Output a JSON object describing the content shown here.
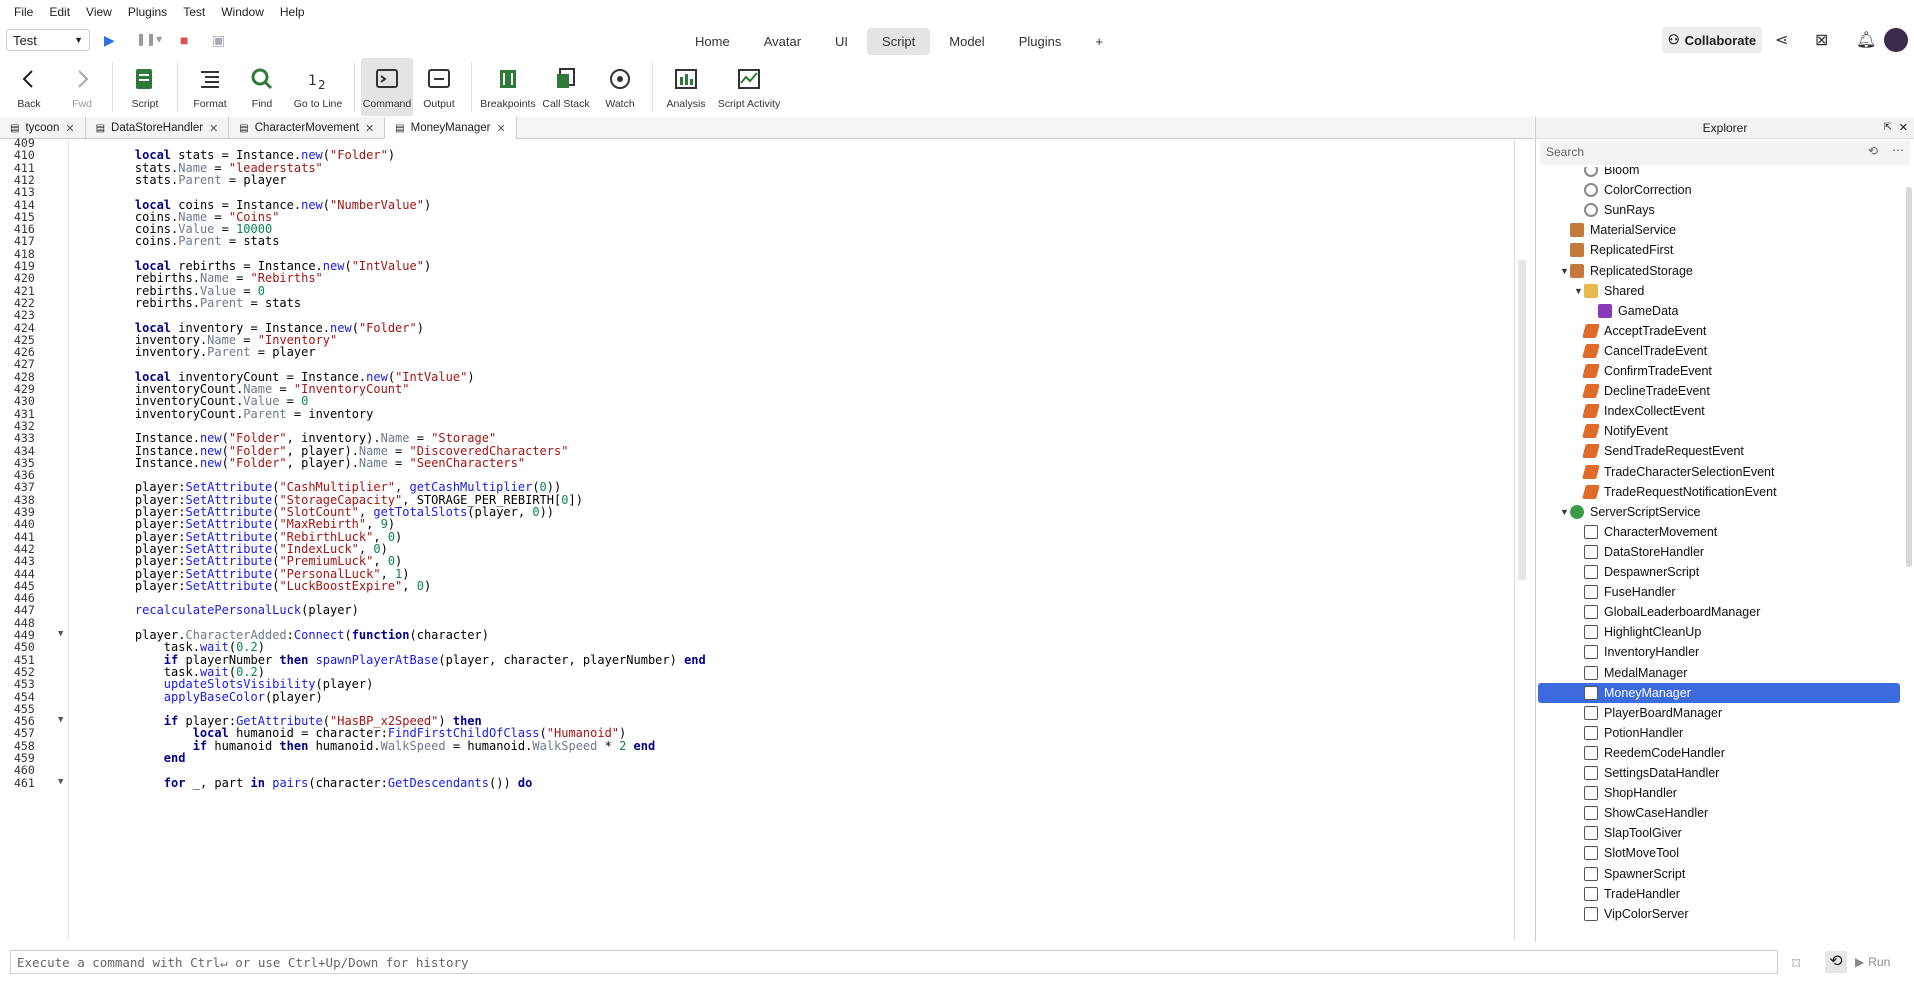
{
  "menu": [
    "File",
    "Edit",
    "View",
    "Plugins",
    "Test",
    "Window",
    "Help"
  ],
  "place": {
    "value": "Test"
  },
  "top_tabs": [
    "Home",
    "Avatar",
    "UI",
    "Script",
    "Model",
    "Plugins",
    "+"
  ],
  "collaborate": "Collaborate",
  "toolbar": {
    "back": "Back",
    "fwd": "Fwd",
    "script": "Script",
    "format": "Format",
    "find": "Find",
    "goto": "Go to Line",
    "command": "Command",
    "output": "Output",
    "breakpoints": "Breakpoints",
    "callstack": "Call Stack",
    "watch": "Watch",
    "analysis": "Analysis",
    "activity": "Script Activity"
  },
  "doc_tabs": [
    "tycoon",
    "DataStoreHandler",
    "CharacterMovement",
    "MoneyManager"
  ],
  "code_lines": [
    {
      "n": "409",
      "t": ""
    },
    {
      "n": "410",
      "t": "    local stats = Instance.new(\"Folder\")"
    },
    {
      "n": "411",
      "t": "    stats.Name = \"leaderstats\""
    },
    {
      "n": "412",
      "t": "    stats.Parent = player"
    },
    {
      "n": "413",
      "t": ""
    },
    {
      "n": "414",
      "t": "    local coins = Instance.new(\"NumberValue\")"
    },
    {
      "n": "415",
      "t": "    coins.Name = \"Coins\""
    },
    {
      "n": "416",
      "t": "    coins.Value = 10000"
    },
    {
      "n": "417",
      "t": "    coins.Parent = stats"
    },
    {
      "n": "418",
      "t": ""
    },
    {
      "n": "419",
      "t": "    local rebirths = Instance.new(\"IntValue\")"
    },
    {
      "n": "420",
      "t": "    rebirths.Name = \"Rebirths\""
    },
    {
      "n": "421",
      "t": "    rebirths.Value = 0"
    },
    {
      "n": "422",
      "t": "    rebirths.Parent = stats"
    },
    {
      "n": "423",
      "t": ""
    },
    {
      "n": "424",
      "t": "    local inventory = Instance.new(\"Folder\")"
    },
    {
      "n": "425",
      "t": "    inventory.Name = \"Inventory\""
    },
    {
      "n": "426",
      "t": "    inventory.Parent = player"
    },
    {
      "n": "427",
      "t": ""
    },
    {
      "n": "428",
      "t": "    local inventoryCount = Instance.new(\"IntValue\")"
    },
    {
      "n": "429",
      "t": "    inventoryCount.Name = \"InventoryCount\""
    },
    {
      "n": "430",
      "t": "    inventoryCount.Value = 0"
    },
    {
      "n": "431",
      "t": "    inventoryCount.Parent = inventory"
    },
    {
      "n": "432",
      "t": ""
    },
    {
      "n": "433",
      "t": "    Instance.new(\"Folder\", inventory).Name = \"Storage\""
    },
    {
      "n": "434",
      "t": "    Instance.new(\"Folder\", player).Name = \"DiscoveredCharacters\""
    },
    {
      "n": "435",
      "t": "    Instance.new(\"Folder\", player).Name = \"SeenCharacters\""
    },
    {
      "n": "436",
      "t": ""
    },
    {
      "n": "437",
      "t": "    player:SetAttribute(\"CashMultiplier\", getCashMultiplier(0))"
    },
    {
      "n": "438",
      "t": "    player:SetAttribute(\"StorageCapacity\", STORAGE_PER_REBIRTH[0])"
    },
    {
      "n": "439",
      "t": "    player:SetAttribute(\"SlotCount\", getTotalSlots(player, 0))"
    },
    {
      "n": "440",
      "t": "    player:SetAttribute(\"MaxRebirth\", 9)"
    },
    {
      "n": "441",
      "t": "    player:SetAttribute(\"RebirthLuck\", 0)"
    },
    {
      "n": "442",
      "t": "    player:SetAttribute(\"IndexLuck\", 0)"
    },
    {
      "n": "443",
      "t": "    player:SetAttribute(\"PremiumLuck\", 0)"
    },
    {
      "n": "444",
      "t": "    player:SetAttribute(\"PersonalLuck\", 1)"
    },
    {
      "n": "445",
      "t": "    player:SetAttribute(\"LuckBoostExpire\", 0)"
    },
    {
      "n": "446",
      "t": ""
    },
    {
      "n": "447",
      "t": "    recalculatePersonalLuck(player)"
    },
    {
      "n": "448",
      "t": ""
    },
    {
      "n": "449",
      "t": "    player.CharacterAdded:Connect(function(character)"
    },
    {
      "n": "450",
      "t": "        task.wait(0.2)"
    },
    {
      "n": "451",
      "t": "        if playerNumber then spawnPlayerAtBase(player, character, playerNumber) end"
    },
    {
      "n": "452",
      "t": "        task.wait(0.2)"
    },
    {
      "n": "453",
      "t": "        updateSlotsVisibility(player)"
    },
    {
      "n": "454",
      "t": "        applyBaseColor(player)"
    },
    {
      "n": "455",
      "t": ""
    },
    {
      "n": "456",
      "t": "        if player:GetAttribute(\"HasBP_x2Speed\") then"
    },
    {
      "n": "457",
      "t": "            local humanoid = character:FindFirstChildOfClass(\"Humanoid\")"
    },
    {
      "n": "458",
      "t": "            if humanoid then humanoid.WalkSpeed = humanoid.WalkSpeed * 2 end"
    },
    {
      "n": "459",
      "t": "        end"
    },
    {
      "n": "460",
      "t": ""
    },
    {
      "n": "461",
      "t": "        for _, part in pairs(character:GetDescendants()) do"
    }
  ],
  "explorer": {
    "title": "Explorer",
    "search_placeholder": "Search",
    "items": [
      {
        "label": "Bloom",
        "icon": "effect",
        "depth": 2
      },
      {
        "label": "ColorCorrection",
        "icon": "effect",
        "depth": 2
      },
      {
        "label": "SunRays",
        "icon": "effect",
        "depth": 2
      },
      {
        "label": "MaterialService",
        "icon": "service",
        "depth": 1
      },
      {
        "label": "ReplicatedFirst",
        "icon": "service",
        "depth": 1
      },
      {
        "label": "ReplicatedStorage",
        "icon": "service",
        "depth": 1,
        "expanded": true
      },
      {
        "label": "Shared",
        "icon": "folder",
        "depth": 2,
        "expanded": true
      },
      {
        "label": "GameData",
        "icon": "module",
        "depth": 3
      },
      {
        "label": "AcceptTradeEvent",
        "icon": "remote",
        "depth": 2
      },
      {
        "label": "CancelTradeEvent",
        "icon": "remote",
        "depth": 2
      },
      {
        "label": "ConfirmTradeEvent",
        "icon": "remote",
        "depth": 2
      },
      {
        "label": "DeclineTradeEvent",
        "icon": "remote",
        "depth": 2
      },
      {
        "label": "IndexCollectEvent",
        "icon": "remote",
        "depth": 2
      },
      {
        "label": "NotifyEvent",
        "icon": "remote",
        "depth": 2
      },
      {
        "label": "SendTradeRequestEvent",
        "icon": "remote",
        "depth": 2
      },
      {
        "label": "TradeCharacterSelectionEvent",
        "icon": "remote",
        "depth": 2
      },
      {
        "label": "TradeRequestNotificationEvent",
        "icon": "remote",
        "depth": 2
      },
      {
        "label": "ServerScriptService",
        "icon": "sss",
        "depth": 1,
        "expanded": true
      },
      {
        "label": "CharacterMovement",
        "icon": "script",
        "depth": 2
      },
      {
        "label": "DataStoreHandler",
        "icon": "script",
        "depth": 2
      },
      {
        "label": "DespawnerScript",
        "icon": "script",
        "depth": 2
      },
      {
        "label": "FuseHandler",
        "icon": "script",
        "depth": 2
      },
      {
        "label": "GlobalLeaderboardManager",
        "icon": "script",
        "depth": 2
      },
      {
        "label": "HighlightCleanUp",
        "icon": "script",
        "depth": 2
      },
      {
        "label": "InventoryHandler",
        "icon": "script",
        "depth": 2
      },
      {
        "label": "MedalManager",
        "icon": "script",
        "depth": 2
      },
      {
        "label": "MoneyManager",
        "icon": "script",
        "depth": 2,
        "selected": true
      },
      {
        "label": "PlayerBoardManager",
        "icon": "script",
        "depth": 2
      },
      {
        "label": "PotionHandler",
        "icon": "script",
        "depth": 2
      },
      {
        "label": "ReedemCodeHandler",
        "icon": "script",
        "depth": 2
      },
      {
        "label": "SettingsDataHandler",
        "icon": "script",
        "depth": 2
      },
      {
        "label": "ShopHandler",
        "icon": "script",
        "depth": 2
      },
      {
        "label": "ShowCaseHandler",
        "icon": "script",
        "depth": 2
      },
      {
        "label": "SlapToolGiver",
        "icon": "script",
        "depth": 2
      },
      {
        "label": "SlotMoveTool",
        "icon": "script",
        "depth": 2
      },
      {
        "label": "SpawnerScript",
        "icon": "script",
        "depth": 2
      },
      {
        "label": "TradeHandler",
        "icon": "script",
        "depth": 2
      },
      {
        "label": "VipColorServer",
        "icon": "script",
        "depth": 2
      }
    ]
  },
  "command": {
    "placeholder": "Execute a command with Ctrl↵ or use Ctrl+Up/Down for history",
    "run": "Run"
  },
  "colors": {
    "selection": "#3c6be0",
    "keyword": "#00008b",
    "string": "#a31515",
    "number": "#098658"
  }
}
